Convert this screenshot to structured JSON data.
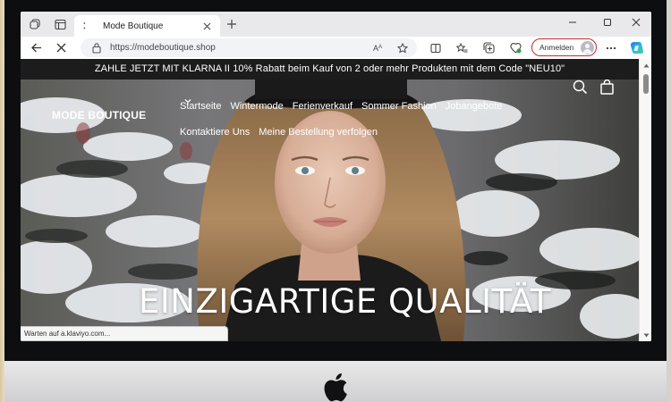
{
  "browser": {
    "tab": {
      "title": "Mode Boutique"
    },
    "address": {
      "url": "https://modeboutique.shop"
    },
    "signin_label": "Anmelden"
  },
  "site": {
    "announcement": "ZAHLE JETZT MIT KLARNA II 10% Rabatt beim Kauf von 2 oder mehr Produkten mit dem Code \"NEU10\"",
    "logo": "MODE BOUTIQUE",
    "nav": [
      {
        "label": "Startseite"
      },
      {
        "label": "Wintermode"
      },
      {
        "label": "Ferienverkauf"
      },
      {
        "label": "Sommer Fashion"
      },
      {
        "label": "Jobangebote"
      },
      {
        "label": "Kontaktiere Uns"
      },
      {
        "label": "Meine Bestellung verfolgen"
      }
    ],
    "headline": "EINZIGARTIGE QUALITÄT"
  },
  "statusbar": {
    "text": "Warten auf a.klaviyo.com..."
  },
  "icons": {
    "tab_actions": "tab-actions-icon",
    "vertical_tabs": "vertical-tabs-icon",
    "back": "back-arrow-icon",
    "stop": "stop-loading-icon",
    "lock": "lock-icon",
    "read_aloud": "read-aloud-icon",
    "favorite": "star-icon",
    "split": "split-screen-icon",
    "favorites": "favorites-icon",
    "collections": "collections-icon",
    "browser_essentials": "browser-essentials-icon",
    "more": "more-icon",
    "copilot": "copilot-icon",
    "search": "search-icon",
    "cart": "cart-icon"
  },
  "colors": {
    "announcement_bg": "#1c1c1c",
    "signin_border": "#c42b2b",
    "tab_bar_bg": "#e9e9eb"
  }
}
